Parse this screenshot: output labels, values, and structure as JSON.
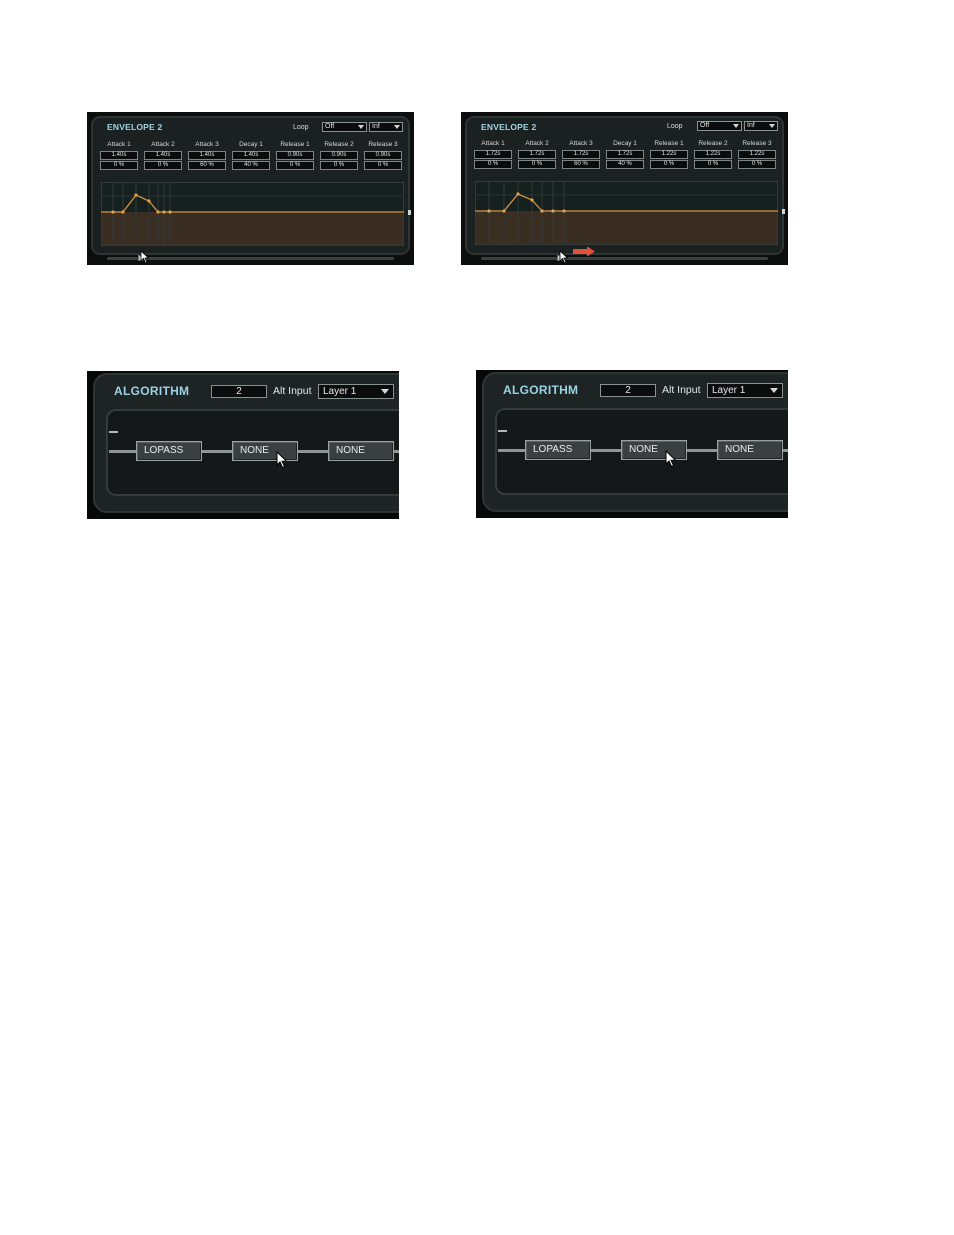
{
  "envelope_left": {
    "title": "ENVELOPE 2",
    "loop_label": "Loop",
    "loop_value": "Off",
    "count_value": "Inf",
    "params": [
      {
        "label": "Attack 1",
        "time": "1.40s",
        "level": "0 %"
      },
      {
        "label": "Attack 2",
        "time": "1.40s",
        "level": "0 %"
      },
      {
        "label": "Attack 3",
        "time": "1.40s",
        "level": "60 %"
      },
      {
        "label": "Decay 1",
        "time": "1.40s",
        "level": "40 %"
      },
      {
        "label": "Release 1",
        "time": "0.90s",
        "level": "0 %"
      },
      {
        "label": "Release 2",
        "time": "0.90s",
        "level": "0 %"
      },
      {
        "label": "Release 3",
        "time": "0.90s",
        "level": "0 %"
      }
    ]
  },
  "envelope_right": {
    "title": "ENVELOPE 2",
    "loop_label": "Loop",
    "loop_value": "Off",
    "count_value": "Inf",
    "params": [
      {
        "label": "Attack 1",
        "time": "1.72s",
        "level": "0 %"
      },
      {
        "label": "Attack 2",
        "time": "1.72s",
        "level": "0 %"
      },
      {
        "label": "Attack 3",
        "time": "1.72s",
        "level": "60 %"
      },
      {
        "label": "Decay 1",
        "time": "1.72s",
        "level": "40 %"
      },
      {
        "label": "Release 1",
        "time": "1.22s",
        "level": "0 %"
      },
      {
        "label": "Release 2",
        "time": "1.22s",
        "level": "0 %"
      },
      {
        "label": "Release 3",
        "time": "1.22s",
        "level": "0 %"
      }
    ],
    "drag_arrow_color": "#e0503a"
  },
  "algorithm_left": {
    "title": "ALGORITHM",
    "number": "2",
    "alt_input_label": "Alt Input",
    "layer_value": "Layer 1",
    "blocks": [
      "LOPASS",
      "NONE",
      "NONE"
    ]
  },
  "algorithm_right": {
    "title": "ALGORITHM",
    "number": "2",
    "alt_input_label": "Alt Input",
    "layer_value": "Layer 1",
    "blocks": [
      "LOPASS",
      "NONE",
      "NONE"
    ]
  },
  "colors": {
    "accent_title": "#9fd6e6",
    "envelope_line": "#d89440",
    "envelope_fill": "#3a2d22"
  }
}
